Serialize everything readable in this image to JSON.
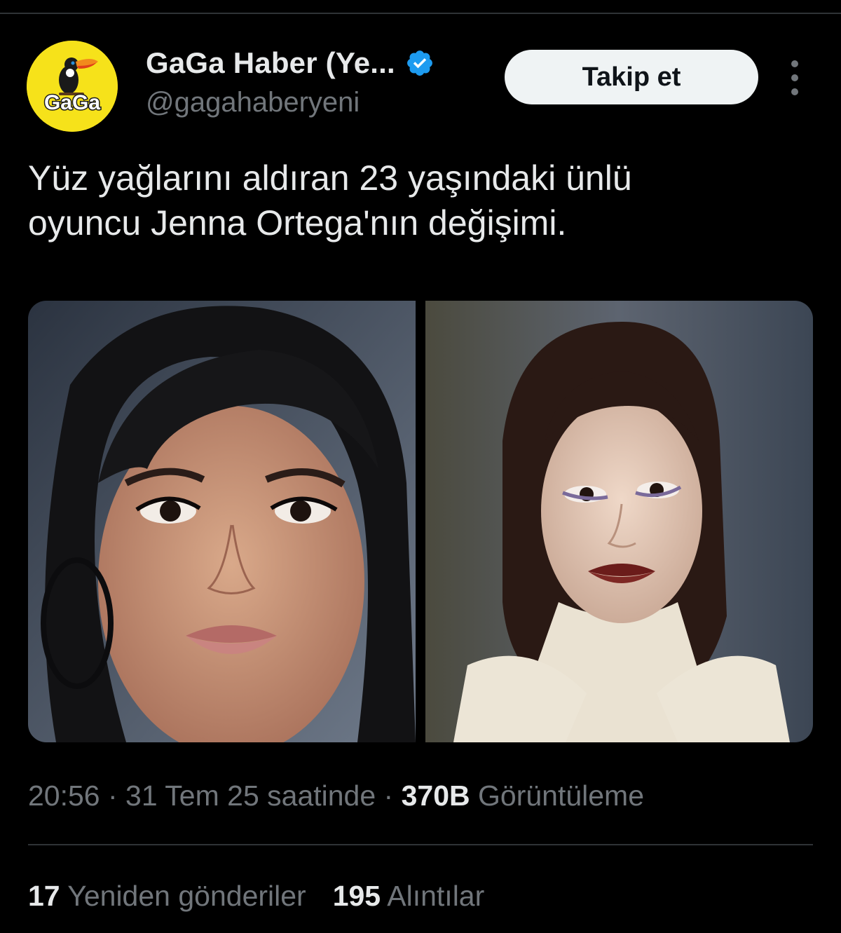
{
  "header": {
    "avatar_text": "GaGa",
    "display_name": "GaGa Haber (Ye...",
    "handle": "@gagahaberyeni",
    "follow_label": "Takip et",
    "verified": true
  },
  "tweet": {
    "text_line1": "Yüz yağlarını aldıran 23 yaşındaki ünlü",
    "text_line2": "oyuncu Jenna Ortega'nın değişimi."
  },
  "meta": {
    "time": "20:56",
    "sep1": " · ",
    "date": "31 Tem 25 saatinde",
    "sep2": " · ",
    "views_count": "370B",
    "views_label": " Görüntüleme"
  },
  "stats": {
    "reposts_count": "17",
    "reposts_label": "Yeniden gönderiler",
    "quotes_count": "195",
    "quotes_label": "Alıntılar"
  },
  "colors": {
    "background": "#000000",
    "text_primary": "#e7e9ea",
    "text_secondary": "#71767b",
    "verified_blue": "#1d9bf0",
    "avatar_yellow": "#f6e21a",
    "button_bg": "#eff3f4"
  },
  "icons": [
    "toucan-logo-icon",
    "verified-badge-icon",
    "more-options-icon"
  ]
}
